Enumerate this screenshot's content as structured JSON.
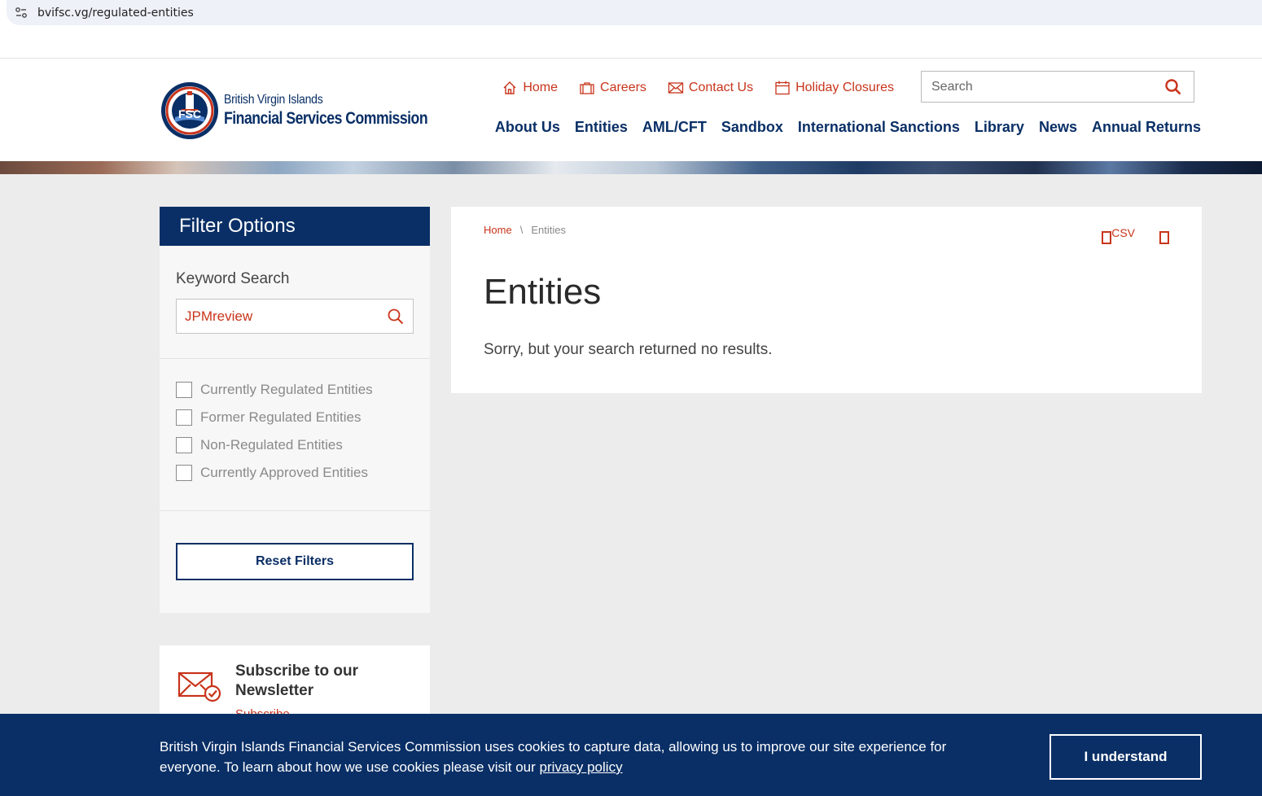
{
  "browser": {
    "url": "bvifsc.vg/regulated-entities"
  },
  "logo": {
    "line1": "British Virgin Islands",
    "line2": "Financial Services Commission",
    "seal_text": "FSC"
  },
  "utility_nav": [
    {
      "label": "Home",
      "icon": "home-icon"
    },
    {
      "label": "Careers",
      "icon": "briefcase-icon"
    },
    {
      "label": "Contact Us",
      "icon": "envelope-icon"
    },
    {
      "label": "Holiday Closures",
      "icon": "calendar-icon"
    }
  ],
  "header_search": {
    "placeholder": "Search"
  },
  "main_nav": [
    "About Us",
    "Entities",
    "AML/CFT",
    "Sandbox",
    "International Sanctions",
    "Library",
    "News",
    "Annual Returns"
  ],
  "filter": {
    "title": "Filter Options",
    "keyword_label": "Keyword Search",
    "keyword_value": "JPMreview",
    "options": [
      {
        "label": "Currently Regulated Entities",
        "checked": false
      },
      {
        "label": "Former Regulated Entities",
        "checked": false
      },
      {
        "label": "Non-Regulated Entities",
        "checked": false
      },
      {
        "label": "Currently Approved Entities",
        "checked": false
      }
    ],
    "reset_label": "Reset Filters"
  },
  "newsletter": {
    "title": "Subscribe to our Newsletter",
    "link": "Subscribe"
  },
  "content": {
    "breadcrumb_home": "Home",
    "breadcrumb_sep": "\\",
    "breadcrumb_current": "Entities",
    "csv_label": "CSV",
    "title": "Entities",
    "message": "Sorry, but your search returned no results."
  },
  "cookie": {
    "text": "British Virgin Islands Financial Services Commission uses cookies to capture data, allowing us to improve our site experience for everyone. To learn about how we use cookies please visit our",
    "link": "privacy policy",
    "button": "I understand"
  },
  "colors": {
    "navy": "#0a2f66",
    "accent_red": "#c8341b",
    "background": "#ececec"
  }
}
